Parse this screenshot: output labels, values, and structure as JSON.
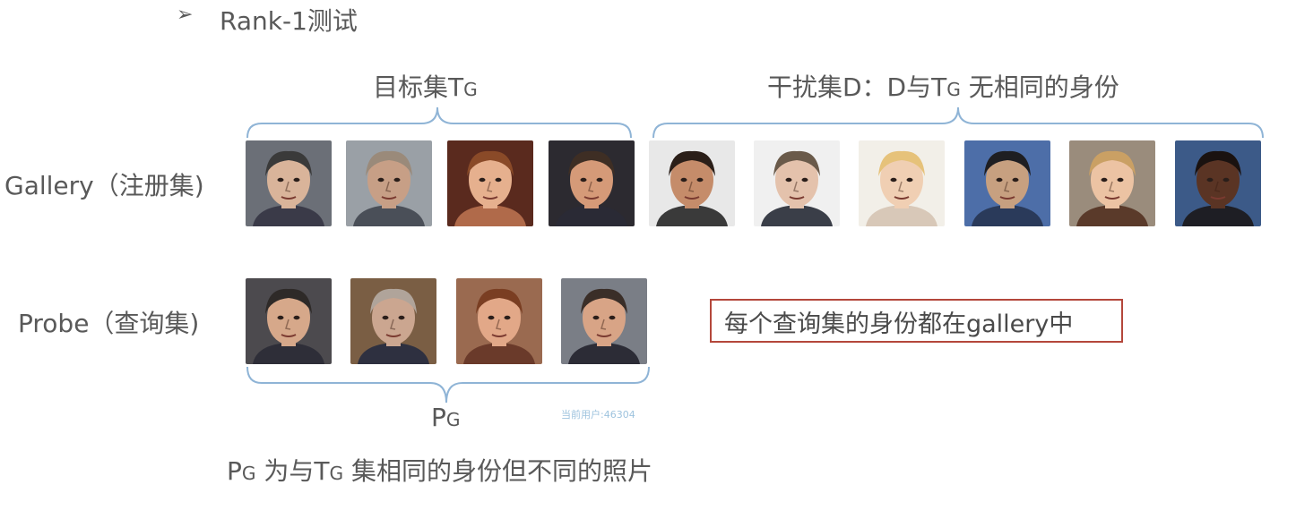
{
  "section": {
    "bullet": "➢",
    "title": "Rank-1测试"
  },
  "braces": {
    "target_set": {
      "main": "目标集T",
      "sub": "G"
    },
    "distractor_set": {
      "pre": "干扰集D：D与T",
      "sub": "G",
      "post": " 无相同的身份"
    },
    "probe_set": {
      "main": "P",
      "sub": "G"
    }
  },
  "rows": {
    "gallery": "Gallery（注册集)",
    "probe": "Probe（查询集)"
  },
  "note": "每个查询集的身份都在gallery中",
  "watermark": "当前用户:46304",
  "caption": {
    "p": "P",
    "p_sub": "G",
    "mid": " 为与T",
    "t_sub": "G",
    "post": " 集相同的身份但不同的照片"
  },
  "faces": {
    "gallery": [
      {
        "skin": "#d9b49a",
        "hair": "#3a3a3a",
        "bg": "#6b6f77",
        "cloth": "#3a3a48"
      },
      {
        "skin": "#c79f86",
        "hair": "#9a8a7a",
        "bg": "#9aa0a6",
        "cloth": "#4a4f58"
      },
      {
        "skin": "#e6b08e",
        "hair": "#8a4a28",
        "bg": "#5a2a1e",
        "cloth": "#b06a4a"
      },
      {
        "skin": "#d59a78",
        "hair": "#3e2e24",
        "bg": "#2c2a30",
        "cloth": "#2a2a35"
      },
      {
        "skin": "#c58c6a",
        "hair": "#2a1e18",
        "bg": "#e8e8e8",
        "cloth": "#3a3a3a"
      },
      {
        "skin": "#e4c2ac",
        "hair": "#6a5a4a",
        "bg": "#f0f0f0",
        "cloth": "#3a3e48"
      },
      {
        "skin": "#f0cfb3",
        "hair": "#e6c27a",
        "bg": "#f2efe8",
        "cloth": "#d8c8b8"
      },
      {
        "skin": "#c7a080",
        "hair": "#1e1e22",
        "bg": "#4d6ea8",
        "cloth": "#2a3a5a"
      },
      {
        "skin": "#ecc3a3",
        "hair": "#caa064",
        "bg": "#9a8c7c",
        "cloth": "#5a3a2a"
      },
      {
        "skin": "#5a3424",
        "hair": "#1a1210",
        "bg": "#3c5a88",
        "cloth": "#1e1e24"
      }
    ],
    "probe": [
      {
        "skin": "#d6a88a",
        "hair": "#2e2a28",
        "bg": "#4c4a4e",
        "cloth": "#2e2e38"
      },
      {
        "skin": "#cba690",
        "hair": "#b0a49a",
        "bg": "#7a5e44",
        "cloth": "#2e3040"
      },
      {
        "skin": "#e2a888",
        "hair": "#7a3e22",
        "bg": "#9a6a50",
        "cloth": "#6a3a2a"
      },
      {
        "skin": "#d8a486",
        "hair": "#3a2e28",
        "bg": "#7a7e86",
        "cloth": "#2c2c36"
      }
    ],
    "icon": "face-photo-icon"
  },
  "colors": {
    "text": "#595959",
    "brace": "#8fb4d6",
    "note_border": "#b4473b",
    "watermark": "#9ec3de"
  }
}
